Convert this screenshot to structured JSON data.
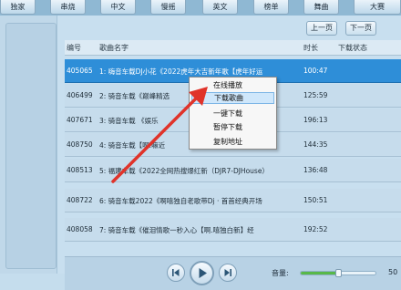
{
  "categories": [
    "独家",
    "串烧",
    "中文",
    "慢摇",
    "英文",
    "榜单",
    "舞曲",
    "大赛"
  ],
  "pager": {
    "prev": "上一页",
    "next": "下一页"
  },
  "columns": {
    "num": "编号",
    "title": "歌曲名字",
    "duration": "时长",
    "status": "下载状态"
  },
  "songs": [
    {
      "num": "405065",
      "title": "1: 嗨音车载DJ小花《2022虎年大吉新年歌【虎年好运",
      "duration": "100:47",
      "status": "",
      "selected": true
    },
    {
      "num": "406499",
      "title": "2: 骑音车载《巅峰精选",
      "duration": "125:59",
      "status": "",
      "selected": false
    },
    {
      "num": "407671",
      "title": "3: 骑音车载 《娱乐",
      "duration": "196:13",
      "status": "",
      "selected": false
    },
    {
      "num": "408750",
      "title": "4: 骑音车载【啊.嘛近",
      "duration": "144:35",
      "status": "",
      "selected": false
    },
    {
      "num": "408513",
      "title": "5: 福建车载《2022全网热搜爆红新（DJR7-DJHouse）",
      "duration": "136:48",
      "status": "",
      "selected": false
    },
    {
      "num": "408722",
      "title": "6: 骑音车载2022《啊嘻独自老歌带Dj · 首首经典开场",
      "duration": "150:51",
      "status": "",
      "selected": false
    },
    {
      "num": "408058",
      "title": "7: 骑音车载《催泪情歌一秒入心【啊.嘻独白新】经",
      "duration": "192:52",
      "status": "",
      "selected": false
    }
  ],
  "context_menu": [
    {
      "label": "在线播放",
      "highlighted": false
    },
    {
      "label": "下载歌曲",
      "highlighted": true
    },
    {
      "label": "一键下载",
      "highlighted": false
    },
    {
      "label": "暂停下载",
      "highlighted": false
    },
    {
      "label": "复制地址",
      "highlighted": false
    }
  ],
  "player": {
    "prev_icon": "skip-previous-icon",
    "play_icon": "play-icon",
    "next_icon": "skip-next-icon",
    "volume_label": "音量:",
    "volume_value": "50",
    "volume_fraction": 0.5
  },
  "colors": {
    "selected_row": "#2e8ed8",
    "annotation_arrow": "#e0332a",
    "volume_fill": "#58b848"
  }
}
